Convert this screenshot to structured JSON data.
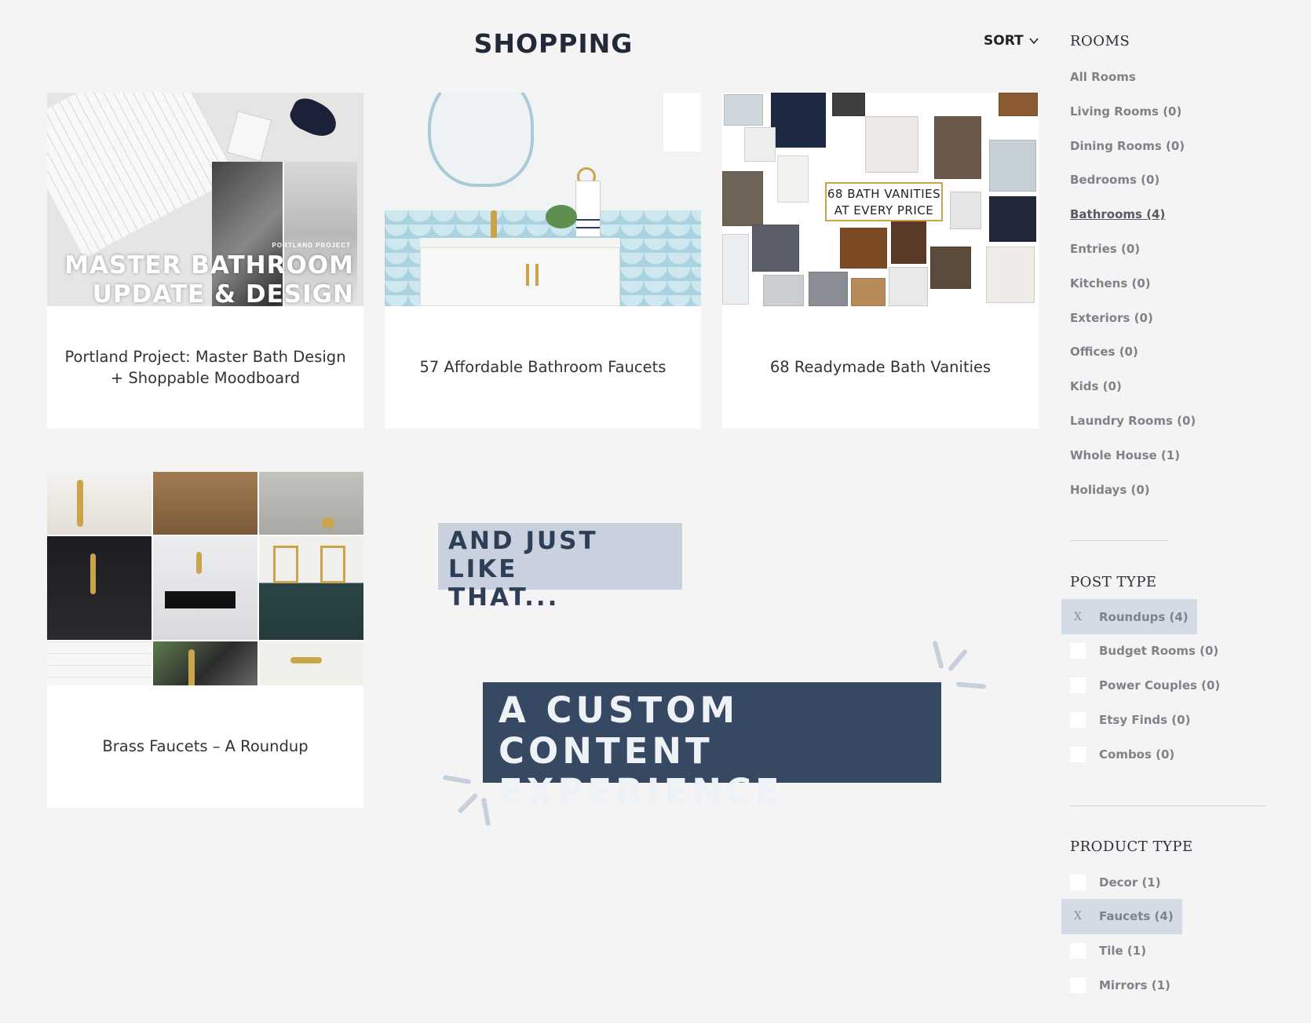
{
  "header": {
    "title": "SHOPPING",
    "sort_label": "SORT"
  },
  "cards": [
    {
      "caption": "Portland Project: Master Bath Design + Shoppable Moodboard",
      "overlay_small": "PORTLAND PROJECT",
      "overlay_line1": "MASTER BATHROOM",
      "overlay_line2": "UPDATE & DESIGN"
    },
    {
      "caption": "57 Affordable Bathroom Faucets"
    },
    {
      "caption": "68 Readymade Bath Vanities",
      "overlay_line1": "68 BATH VANITIES",
      "overlay_line2": "AT EVERY PRICE"
    },
    {
      "caption": "Brass Faucets – A Roundup"
    }
  ],
  "promo": {
    "line1a": "AND JUST LIKE",
    "line1b": "THAT...",
    "line2a": "A CUSTOM CONTENT",
    "line2b": "EXPERIENCE"
  },
  "sidebar": {
    "rooms_title": "ROOMS",
    "rooms": [
      {
        "label": "All Rooms"
      },
      {
        "label": "Living Rooms (0)"
      },
      {
        "label": "Dining Rooms (0)"
      },
      {
        "label": "Bedrooms (0)"
      },
      {
        "label": "Bathrooms (4)",
        "active": true
      },
      {
        "label": "Entries (0)"
      },
      {
        "label": "Kitchens (0)"
      },
      {
        "label": "Exteriors (0)"
      },
      {
        "label": "Offices (0)"
      },
      {
        "label": "Kids (0)"
      },
      {
        "label": "Laundry Rooms (0)"
      },
      {
        "label": "Whole House (1)"
      },
      {
        "label": "Holidays (0)"
      }
    ],
    "post_type_title": "POST TYPE",
    "post_types": [
      {
        "label": "Roundups (4)",
        "selected": true,
        "mark": "X"
      },
      {
        "label": "Budget Rooms (0)",
        "selected": false
      },
      {
        "label": "Power Couples (0)",
        "selected": false
      },
      {
        "label": "Etsy Finds (0)",
        "selected": false
      },
      {
        "label": "Combos (0)",
        "selected": false
      }
    ],
    "product_type_title": "PRODUCT TYPE",
    "product_types": [
      {
        "label": "Decor (1)",
        "selected": false
      },
      {
        "label": "Faucets (4)",
        "selected": true,
        "mark": "X"
      },
      {
        "label": "Tile (1)",
        "selected": false
      },
      {
        "label": "Mirrors (1)",
        "selected": false
      }
    ]
  },
  "colors": {
    "background": "#f4f4f4",
    "navy": "#364862",
    "light_blue": "#c8d1dd",
    "selected_filter": "#d3dbe6"
  }
}
